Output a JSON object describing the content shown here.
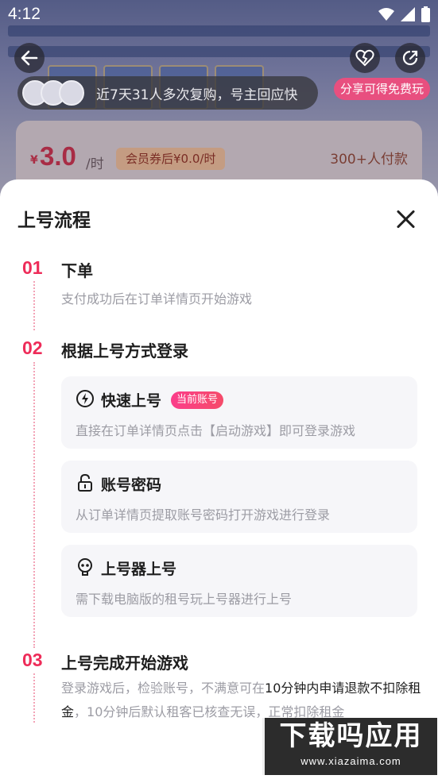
{
  "status_bar": {
    "time": "4:12"
  },
  "background": {
    "buyers_text": "近7天31人多次复购，号主回应快",
    "share_tag": "分享可得免费玩",
    "price_symbol": "¥",
    "price": "3.0",
    "price_unit": "/时",
    "coupon": "会员券后¥0.0/时",
    "paid_count": "300+人付款"
  },
  "sheet": {
    "title": "上号流程",
    "steps": [
      {
        "num": "01",
        "title": "下单",
        "desc": "支付成功后在订单详情页开始游戏"
      },
      {
        "num": "02",
        "title": "根据上号方式登录",
        "options": [
          {
            "icon": "lightning-icon",
            "name": "快速上号",
            "badge": "当前账号",
            "desc": "直接在订单详情页点击【启动游戏】即可登录游戏"
          },
          {
            "icon": "lock-icon",
            "name": "账号密码",
            "desc": "从订单详情页提取账号密码打开游戏进行登录"
          },
          {
            "icon": "launcher-icon",
            "name": "上号器上号",
            "desc": "需下载电脑版的租号玩上号器进行上号"
          }
        ]
      },
      {
        "num": "03",
        "title": "上号完成开始游戏",
        "desc_parts": [
          "登录游戏后，检验账号，不满意可在",
          "10分钟内申请退款不扣除租金",
          "，10分钟后默认租客已核查无误，正常扣除租金"
        ]
      }
    ]
  },
  "watermark": {
    "title": "下载吗应用",
    "url": "www.xiazaima.com"
  },
  "colors": {
    "accent": "#ee2c59",
    "badge": "#fb3d8a",
    "muted": "#9c9ca4"
  }
}
